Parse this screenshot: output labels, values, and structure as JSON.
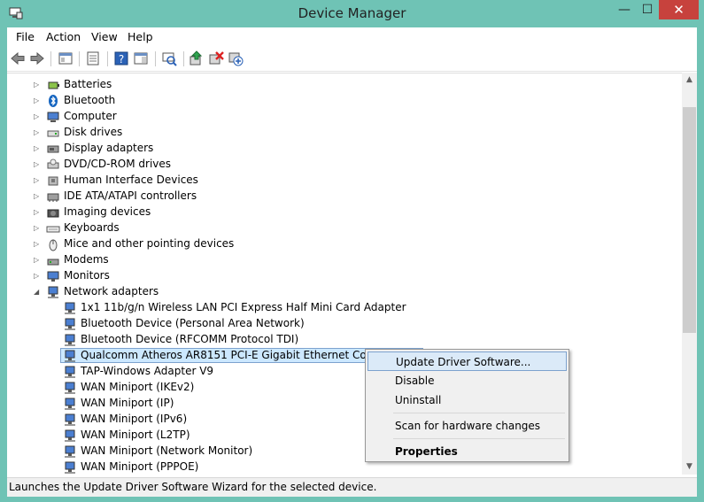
{
  "window": {
    "title": "Device Manager",
    "minimize": "—",
    "maximize": "☐",
    "close": "✕"
  },
  "menu": {
    "file": "File",
    "action": "Action",
    "view": "View",
    "help": "Help"
  },
  "tree": {
    "categories": [
      {
        "label": "Batteries",
        "icon": "battery-icon"
      },
      {
        "label": "Bluetooth",
        "icon": "bluetooth-icon"
      },
      {
        "label": "Computer",
        "icon": "computer-icon"
      },
      {
        "label": "Disk drives",
        "icon": "disk-drive-icon"
      },
      {
        "label": "Display adapters",
        "icon": "display-adapter-icon"
      },
      {
        "label": "DVD/CD-ROM drives",
        "icon": "dvd-drive-icon"
      },
      {
        "label": "Human Interface Devices",
        "icon": "hid-icon"
      },
      {
        "label": "IDE ATA/ATAPI controllers",
        "icon": "ide-controller-icon"
      },
      {
        "label": "Imaging devices",
        "icon": "camera-icon"
      },
      {
        "label": "Keyboards",
        "icon": "keyboard-icon"
      },
      {
        "label": "Mice and other pointing devices",
        "icon": "mouse-icon"
      },
      {
        "label": "Modems",
        "icon": "modem-icon"
      },
      {
        "label": "Monitors",
        "icon": "monitor-icon"
      },
      {
        "label": "Network adapters",
        "icon": "network-adapter-icon"
      }
    ],
    "network_children": [
      "1x1 11b/g/n Wireless LAN PCI Express Half Mini Card Adapter",
      "Bluetooth Device (Personal Area Network)",
      "Bluetooth Device (RFCOMM Protocol TDI)",
      "Qualcomm Atheros AR8151 PCI-E Gigabit Ethernet Controller",
      "TAP-Windows Adapter V9",
      "WAN Miniport (IKEv2)",
      "WAN Miniport (IP)",
      "WAN Miniport (IPv6)",
      "WAN Miniport (L2TP)",
      "WAN Miniport (Network Monitor)",
      "WAN Miniport (PPPOE)"
    ],
    "selected_index": 3
  },
  "context_menu": {
    "update": "Update Driver Software...",
    "disable": "Disable",
    "uninstall": "Uninstall",
    "scan": "Scan for hardware changes",
    "properties": "Properties"
  },
  "status": {
    "text": "Launches the Update Driver Software Wizard for the selected device."
  },
  "colors": {
    "titlebar": "#6fc3b5",
    "close": "#c7423d",
    "selection": "#cce8ff",
    "selection_border": "#7da2ce"
  }
}
